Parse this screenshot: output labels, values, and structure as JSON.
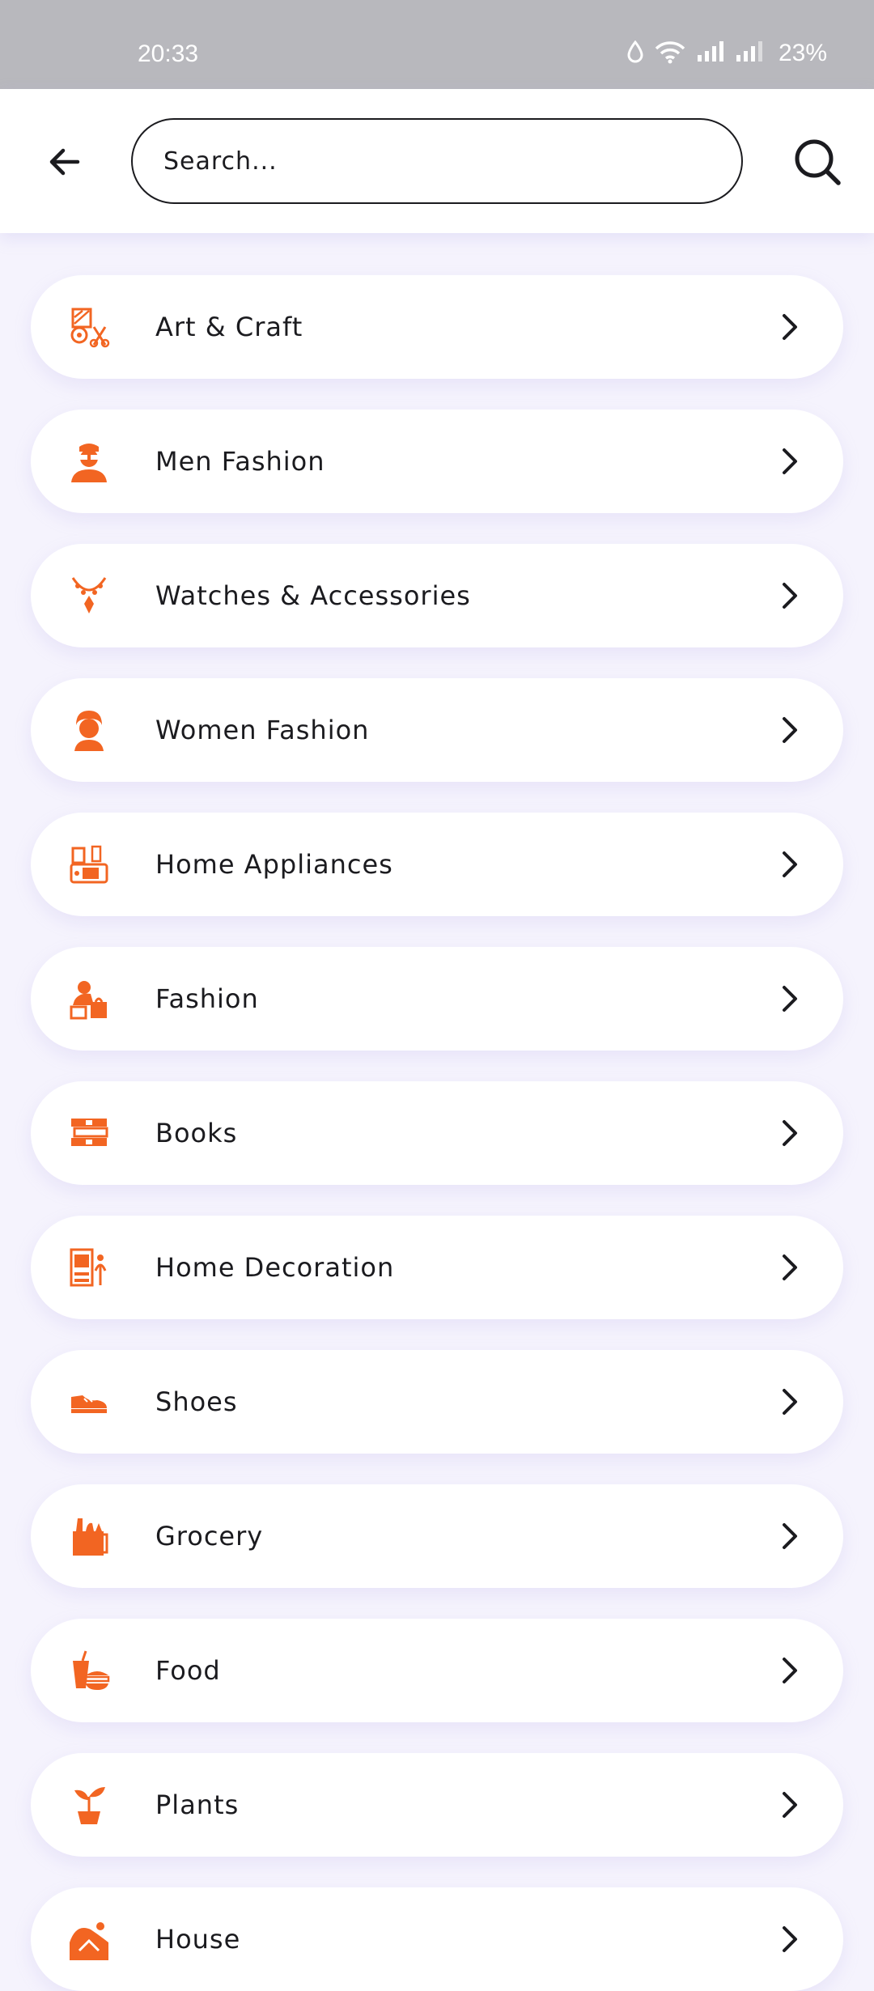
{
  "status_bar": {
    "time": "20:33",
    "battery": "23%",
    "icons": [
      "water-drop-icon",
      "wifi-icon",
      "signal-icon",
      "signal-icon"
    ]
  },
  "header": {
    "back_icon": "arrow-left-icon",
    "search_placeholder": "Search...",
    "search_icon": "search-icon"
  },
  "accent_color": "#f26522",
  "categories": [
    {
      "label": "Art & Craft",
      "icon": "art-craft-icon"
    },
    {
      "label": "Men Fashion",
      "icon": "men-fashion-icon"
    },
    {
      "label": "Watches & Accessories",
      "icon": "necklace-icon"
    },
    {
      "label": "Women Fashion",
      "icon": "women-fashion-icon"
    },
    {
      "label": "Home Appliances",
      "icon": "home-appliances-icon"
    },
    {
      "label": "Fashion",
      "icon": "fashion-icon"
    },
    {
      "label": "Books",
      "icon": "books-icon"
    },
    {
      "label": "Home Decoration",
      "icon": "home-decoration-icon"
    },
    {
      "label": "Shoes",
      "icon": "shoe-icon"
    },
    {
      "label": "Grocery",
      "icon": "grocery-bag-icon"
    },
    {
      "label": "Food",
      "icon": "food-icon"
    },
    {
      "label": "Plants",
      "icon": "plant-icon"
    },
    {
      "label": "House",
      "icon": "house-icon"
    }
  ]
}
